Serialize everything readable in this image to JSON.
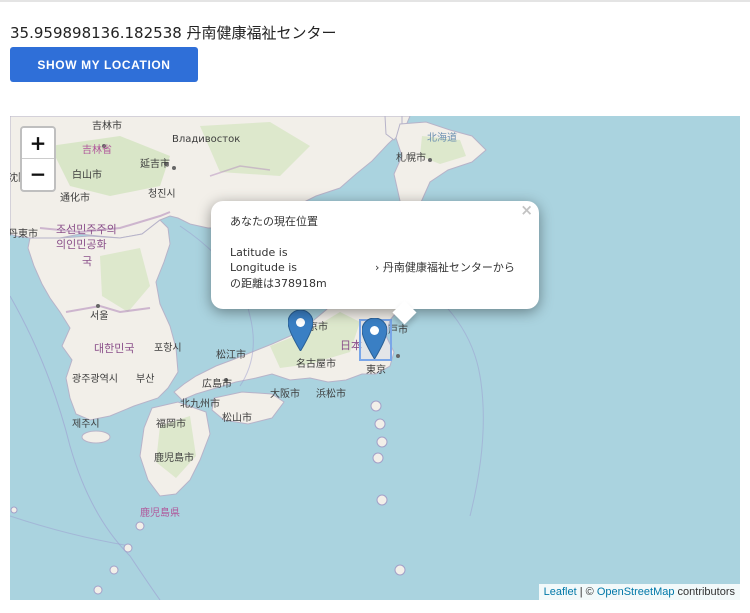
{
  "header": {
    "coords_text": "35.959898136.182538 丹南健康福祉センター",
    "locate_button_label": "SHOW MY LOCATION"
  },
  "map": {
    "zoom_in_label": "+",
    "zoom_out_label": "−",
    "labels": {
      "jilin_city": "吉林市",
      "jilin_prov": "吉林省",
      "vladivostok": "Владивосток",
      "yanji": "延吉市",
      "hokkaido": "北海道",
      "sapporo": "札幌市",
      "baishan": "白山市",
      "qingjin": "청진시",
      "shenyang": "沈阳",
      "tonghua": "通化市",
      "dandong": "丹東市",
      "dprk_kr": "조선민주주의",
      "dprk_cn": "의인민공화",
      "dprk_end": "국",
      "seoul": "서울",
      "rok_cn": "대한민국",
      "pohang": "포항시",
      "matsue": "松江市",
      "gwangju": "광주광역시",
      "busan": "부산",
      "hiroshima": "広島市",
      "nagoya": "名古屋市",
      "kyoto": "京市",
      "nippon": "日本",
      "edo": "戸市",
      "tokyo": "東京",
      "osaka": "大阪市",
      "hamamatsu": "浜松市",
      "kitakyushu": "北九州市",
      "matsuyama": "松山市",
      "jeju": "제주시",
      "fukuoka": "福岡市",
      "kagoshima_city": "鹿児島市",
      "kagoshima_pref": "鹿児島県"
    },
    "popup": {
      "title": "あなたの現在位置",
      "latitude_label": "Latitude is",
      "longitude_label": "Longitude is",
      "distance_text_1": "› 丹南健康福祉センターから",
      "distance_text_2": "の距離は378918m",
      "close_symbol": "×"
    },
    "attribution": {
      "leaflet": "Leaflet",
      "separator": " | © ",
      "osm": "OpenStreetMap",
      "contributors": " contributors"
    },
    "colors": {
      "sea": "#aad3df",
      "land": "#f2efe9",
      "forest": "#cfe3b9",
      "marker": "#3a7fc4",
      "button": "#2f6fd8"
    }
  }
}
